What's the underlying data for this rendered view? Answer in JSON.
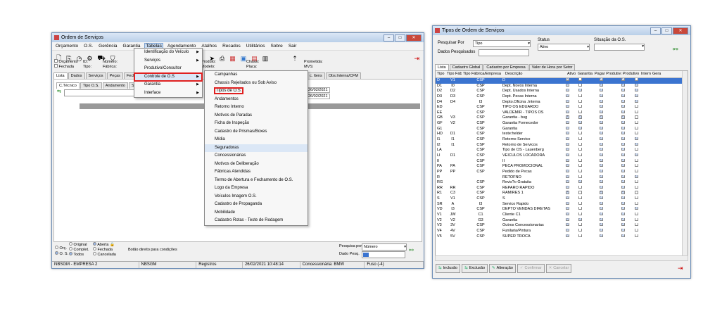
{
  "left_window": {
    "title": "Ordem de Serviços",
    "menu": [
      "Orçamento",
      "O.S.",
      "Gerência",
      "Garantia",
      "Tabelas",
      "Agendamento",
      "Atalhos",
      "Recados",
      "Utilitários",
      "Sobre",
      "Sair"
    ],
    "info": {
      "orcamento": "Orçamento",
      "fechada": "Fechada",
      "id": "ID:",
      "tipo": "Tipo:",
      "numero": "Número:",
      "fabrica": "Fábrica:",
      "produto": "Produto:",
      "modelo": "Modelo:",
      "chassi": "Chassi:",
      "placa": "Placa:",
      "promessa": "Prometida:",
      "mvs": "MVS:"
    },
    "tabs": [
      "Lista",
      "Dados",
      "Serviços",
      "Peças",
      "Fechar"
    ],
    "tabs_right": [
      "c. Itens",
      "Obs.Interna/CFM"
    ],
    "subtabs": [
      "C.Técnico",
      "Tipo O.S.",
      "Andamento",
      "Setor Venda"
    ],
    "dates": [
      "26/02/2021",
      "26/02/2021"
    ],
    "tabelas_menu": [
      "Identificação do Veículo",
      "Serviços",
      "Produtivo/Consultor",
      "Controle de O.S",
      "Garantia",
      "Interface"
    ],
    "submenu": [
      "Campanhas",
      "Chassis Rejeitados ou Sob Aviso",
      "Tipos de O.S.",
      "Andamentos",
      "Retorno Interno",
      "Motivos de Paradas",
      "Ficha de Inspeção",
      "Cadastro de Prismas/Boxes",
      "Mídia",
      "Seguradoras",
      "Concessionárias",
      "Motivos de Deliberação",
      "Fábricas Atendidas",
      "Termo de Abertura e Fechamento de O.S.",
      "Logo da Empresa",
      "Veículos Imagem O.S.",
      "Cadastro de Propaganda",
      "Mobilidade",
      "Cadastro Rotas - Teste de Rodagem"
    ],
    "filters": {
      "orc": "Orç.",
      "os": "O. S.",
      "original": "Original",
      "completo": "Complet.",
      "todos": "Todos",
      "aberta": "Aberta",
      "fechada": "Fechada",
      "cancelada": "Cancelada",
      "hint": "Botão direito para condições"
    },
    "search": {
      "label": "Pesquisa por",
      "value": "Número",
      "data_label": "Dado Pesq."
    },
    "status": [
      "NBSGM - EMPRESA 2",
      "NBSGM",
      "Registros",
      "26/02/2021  10:48:14",
      "Concessionária: BMW",
      "Fuso (-4)"
    ]
  },
  "right_window": {
    "title": "Tipos de Ordem de Serviços",
    "pesquisa_label": "Pesquisar Por",
    "pesquisa_value": "Tipo",
    "dados_label": "Dados Pesquisados",
    "status_label": "Status",
    "status_value": "Ativo",
    "situacao_label": "Situação da O.S.",
    "tabs": [
      "Lista",
      "Cadastro Global",
      "Cadastro por Empresa",
      "Valor de Hora por Setor"
    ],
    "columns": [
      "Tipo",
      "Tipo Fábrica",
      "Tipo Fábrica/Empresa",
      "Descrição",
      "Ativo",
      "Garantia",
      "Pagar Produtivo",
      "Produtivo",
      "Interno",
      "Gera"
    ],
    "rows": [
      [
        "D",
        "V1",
        "CSP",
        "D",
        1,
        0,
        1,
        1,
        0
      ],
      [
        "D1",
        "I0",
        "CSP",
        "Dept. Novos Interna",
        1,
        0,
        1,
        1,
        1
      ],
      [
        "D2",
        "D2",
        "CSP",
        "Dept. Usados Interna",
        1,
        1,
        1,
        1,
        1
      ],
      [
        "D3",
        "D3",
        "CSP",
        "Dept. Pecas Interna",
        1,
        0,
        1,
        1,
        1
      ],
      [
        "D4",
        "D4",
        "I3",
        "Depto.Oficina .Interna",
        1,
        0,
        1,
        1,
        1
      ],
      [
        "ED",
        "",
        "CSP",
        "TIPO OS EDUARDO",
        1,
        0,
        1,
        1,
        0
      ],
      [
        "EE",
        "",
        "CSP",
        "VALDEMIR - TIPOS OS",
        1,
        0,
        1,
        1,
        0
      ],
      [
        "GB",
        "V3",
        "CSP",
        "Garantia - bug",
        1,
        1,
        1,
        1,
        0
      ],
      [
        "GF",
        "V2",
        "CSP",
        "Garantia Fornecedor",
        1,
        1,
        1,
        1,
        0
      ],
      [
        "G1",
        "",
        "CSP",
        "Garantia",
        1,
        1,
        1,
        1,
        0
      ],
      [
        "HD",
        "D1",
        "CSP",
        "teste:helder",
        1,
        0,
        1,
        1,
        0
      ],
      [
        "I1",
        "I1",
        "CSP",
        "Retorno Servico",
        1,
        0,
        1,
        1,
        1
      ],
      [
        "I2",
        "I1",
        "CSP",
        "Retorno de Servicos",
        1,
        0,
        1,
        1,
        1
      ],
      [
        "LA",
        "",
        "CSP",
        "Tipo de OS - Lauenberg",
        1,
        0,
        1,
        1,
        0
      ],
      [
        "LI",
        "D1",
        "CSP",
        "VEICULOS LOCADORA",
        1,
        0,
        1,
        1,
        1
      ],
      [
        "II",
        "",
        "CSP",
        "II",
        1,
        0,
        1,
        1,
        0
      ],
      [
        "PA",
        "PA",
        "CSP",
        "PECA PROMOCIONAL",
        1,
        0,
        1,
        1,
        0
      ],
      [
        "PP",
        "PP",
        "CSP",
        "Pedido de Pecas",
        1,
        0,
        1,
        1,
        0
      ],
      [
        "R",
        "",
        "",
        "RETOFNO",
        1,
        0,
        1,
        1,
        1
      ],
      [
        "RG",
        "",
        "CSP",
        "Revis?o Gratuita",
        1,
        1,
        1,
        1,
        0
      ],
      [
        "RR",
        "RR",
        "CSP",
        "REPARO RAPIDO",
        1,
        0,
        1,
        1,
        0
      ],
      [
        "R1",
        "C3",
        "CSP",
        "RAMIRES 1",
        1,
        0,
        1,
        1,
        0
      ],
      [
        "S",
        "V1",
        "CSP",
        "S",
        1,
        0,
        1,
        1,
        0
      ],
      [
        "SR",
        "A",
        "I3",
        "Servico Rapido",
        1,
        0,
        1,
        1,
        0
      ],
      [
        "VD",
        "I3",
        "CSP",
        "DEPTO VENDAS DIRETAS",
        1,
        0,
        1,
        1,
        1
      ],
      [
        "V1",
        "JW",
        "C1",
        "Cliente C1",
        1,
        0,
        1,
        1,
        0
      ],
      [
        "V2",
        "V2",
        "G3",
        "Garantia",
        1,
        1,
        1,
        1,
        0
      ],
      [
        "V3",
        "3V",
        "CSP",
        "Outros Concessionarias",
        1,
        0,
        1,
        1,
        0
      ],
      [
        "V4",
        "4V",
        "CSP",
        "Funilaria/Pintura",
        1,
        0,
        1,
        1,
        0
      ],
      [
        "V5",
        "5V",
        "CSP",
        "SUPER TROCA",
        1,
        0,
        1,
        1,
        0
      ]
    ],
    "buttons": [
      "Inclusão",
      "Exclusão",
      "Alteração",
      "Confirmar",
      "Cancelar"
    ]
  }
}
